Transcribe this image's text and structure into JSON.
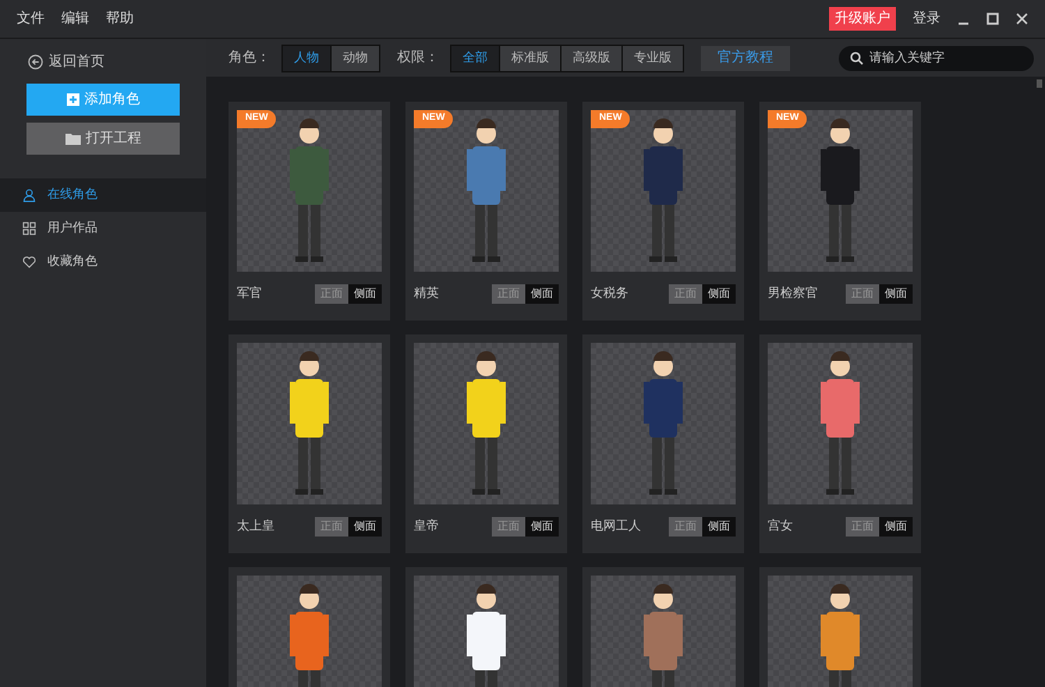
{
  "menu": [
    "文件",
    "编辑",
    "帮助"
  ],
  "title_bar": {
    "upgrade": "升级账户",
    "login": "登录"
  },
  "sidebar": {
    "back": "返回首页",
    "add_button": "添加角色",
    "open_button": "打开工程",
    "items": [
      {
        "label": "在线角色",
        "selected": true
      },
      {
        "label": "用户作品",
        "selected": false
      },
      {
        "label": "收藏角色",
        "selected": false
      }
    ]
  },
  "filters": {
    "role_label": "角色：",
    "roles": [
      {
        "label": "人物",
        "selected": true
      },
      {
        "label": "动物",
        "selected": false
      }
    ],
    "level_label": "权限：",
    "levels": [
      {
        "label": "全部",
        "selected": true
      },
      {
        "label": "标准版",
        "selected": false
      },
      {
        "label": "高级版",
        "selected": false
      },
      {
        "label": "专业版",
        "selected": false
      }
    ],
    "tutorial": "官方教程",
    "search": {
      "placeholder": "请输入关键字"
    }
  },
  "cards": [
    {
      "badge": "NEW",
      "name": "军官",
      "color": "#3d5a3e",
      "views": [
        {
          "label": "正面",
          "selected": false
        },
        {
          "label": "侧面",
          "selected": true
        }
      ]
    },
    {
      "badge": "NEW",
      "name": "精英",
      "color": "#4a7ab0",
      "views": [
        {
          "label": "正面",
          "selected": false
        },
        {
          "label": "侧面",
          "selected": true
        }
      ]
    },
    {
      "badge": "NEW",
      "name": "女税务",
      "color": "#1f2a4a",
      "views": [
        {
          "label": "正面",
          "selected": false
        },
        {
          "label": "侧面",
          "selected": true
        }
      ]
    },
    {
      "badge": "NEW",
      "name": "男检察官",
      "color": "#1a1a1e",
      "views": [
        {
          "label": "正面",
          "selected": false
        },
        {
          "label": "侧面",
          "selected": true
        }
      ]
    },
    {
      "name": "太上皇",
      "color": "#f2d21b",
      "views": [
        {
          "label": "正面",
          "selected": false
        },
        {
          "label": "侧面",
          "selected": true
        }
      ]
    },
    {
      "name": "皇帝",
      "color": "#f2d21b",
      "views": [
        {
          "label": "正面",
          "selected": false
        },
        {
          "label": "侧面",
          "selected": true
        }
      ]
    },
    {
      "name": "电网工人",
      "color": "#1f3160",
      "views": [
        {
          "label": "正面",
          "selected": false
        },
        {
          "label": "侧面",
          "selected": true
        }
      ]
    },
    {
      "name": "宫女",
      "color": "#e86a6a",
      "views": [
        {
          "label": "正面",
          "selected": false
        },
        {
          "label": "侧面",
          "selected": true
        }
      ]
    },
    {
      "color": "#e8641e"
    },
    {
      "color": "#f4f6fa"
    },
    {
      "color": "#a0705a"
    },
    {
      "color": "#e0892a"
    }
  ]
}
